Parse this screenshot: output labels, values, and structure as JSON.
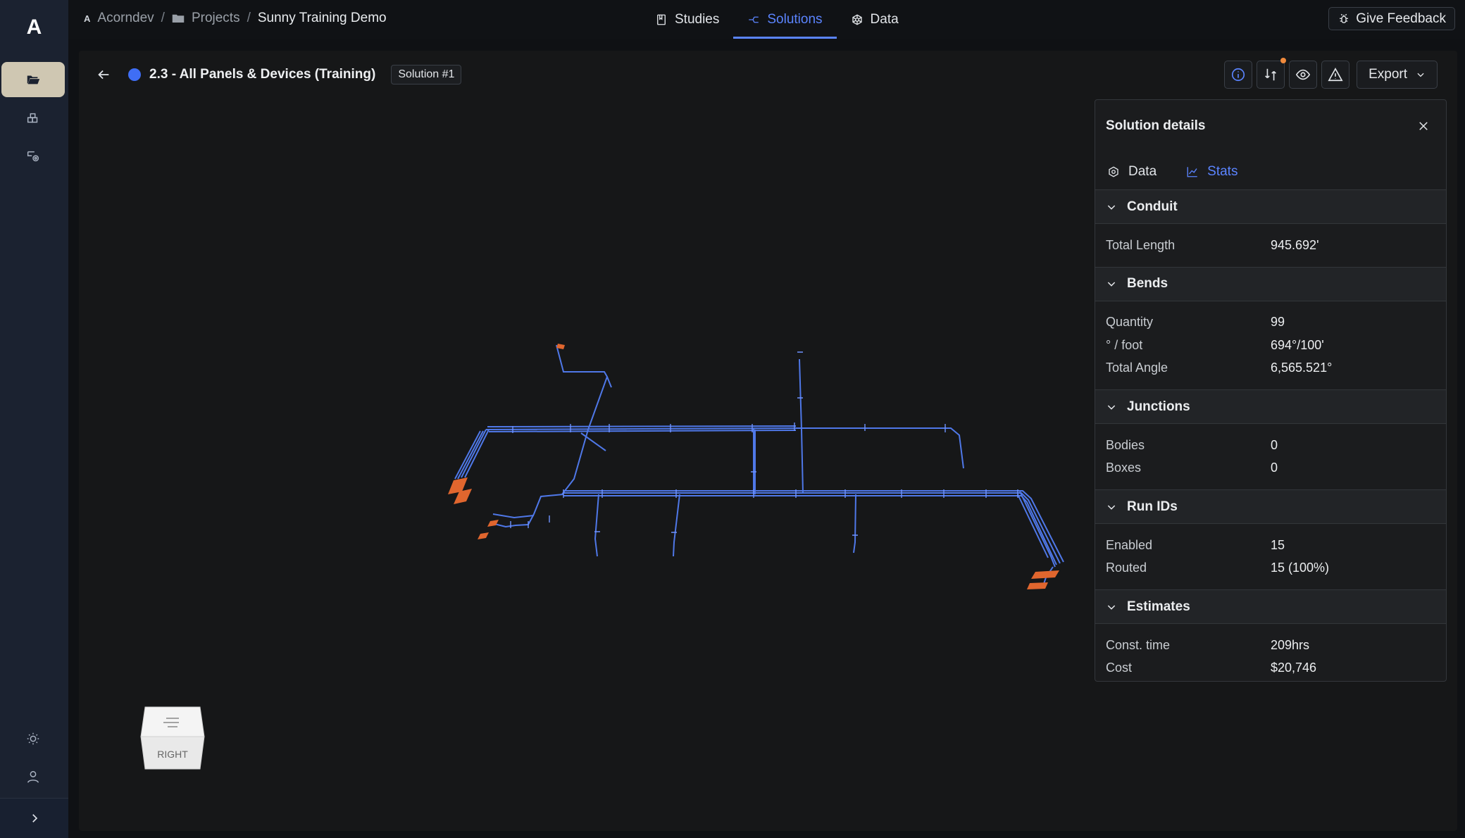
{
  "rail": {
    "logo": "A"
  },
  "breadcrumb": {
    "org": "Acorndev",
    "projects": "Projects",
    "current": "Sunny Training Demo",
    "separator": "/"
  },
  "nav": {
    "tabs": [
      {
        "label": "Studies",
        "icon": "book-icon"
      },
      {
        "label": "Solutions",
        "icon": "route-icon",
        "active": true
      },
      {
        "label": "Data",
        "icon": "data-icon"
      }
    ]
  },
  "feedback": {
    "label": "Give Feedback"
  },
  "study": {
    "title": "2.3 - All Panels & Devices (Training)",
    "solution_badge": "Solution #1",
    "status_color": "#3f6ef5"
  },
  "toolbar": {
    "export_label": "Export"
  },
  "viewcube": {
    "face_label": "RIGHT"
  },
  "panel": {
    "title": "Solution details",
    "tabs": [
      {
        "label": "Data",
        "icon": "data-icon"
      },
      {
        "label": "Stats",
        "icon": "chart-icon",
        "active": true
      }
    ],
    "sections": [
      {
        "title": "Conduit",
        "rows": [
          {
            "k": "Total Length",
            "v": "945.692'"
          }
        ]
      },
      {
        "title": "Bends",
        "rows": [
          {
            "k": "Quantity",
            "v": "99"
          },
          {
            "k": "° / foot",
            "v": "694°/100'"
          },
          {
            "k": "Total Angle",
            "v": "6,565.521°"
          }
        ]
      },
      {
        "title": "Junctions",
        "rows": [
          {
            "k": "Bodies",
            "v": "0"
          },
          {
            "k": "Boxes",
            "v": "0"
          }
        ]
      },
      {
        "title": "Run IDs",
        "rows": [
          {
            "k": "Enabled",
            "v": "15"
          },
          {
            "k": "Routed",
            "v": "15 (100%)"
          }
        ]
      },
      {
        "title": "Estimates",
        "rows": [
          {
            "k": "Const. time",
            "v": "209hrs"
          },
          {
            "k": "Cost",
            "v": "$20,746"
          }
        ]
      }
    ]
  },
  "colors": {
    "accent": "#5b84ff",
    "conduit": "#4f78e8",
    "device": "#e0662e"
  }
}
